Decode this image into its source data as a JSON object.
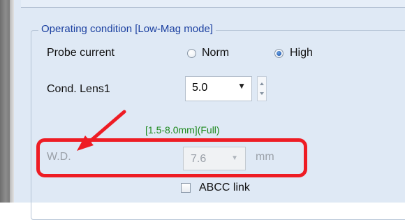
{
  "group": {
    "title": "Operating condition [Low-Mag mode]"
  },
  "probe_current": {
    "label": "Probe current",
    "options": [
      {
        "label": "Norm",
        "selected": false
      },
      {
        "label": "High",
        "selected": true
      }
    ]
  },
  "cond_lens": {
    "label": "Cond. Lens1",
    "value": "5.0"
  },
  "wd": {
    "range_text": "[1.5-8.0mm](Full)",
    "label": "W.D.",
    "value": "7.6",
    "unit": "mm",
    "disabled": true
  },
  "abcc": {
    "label": "ABCC link",
    "checked": false
  },
  "annotation": {
    "color": "#ee1c24"
  }
}
